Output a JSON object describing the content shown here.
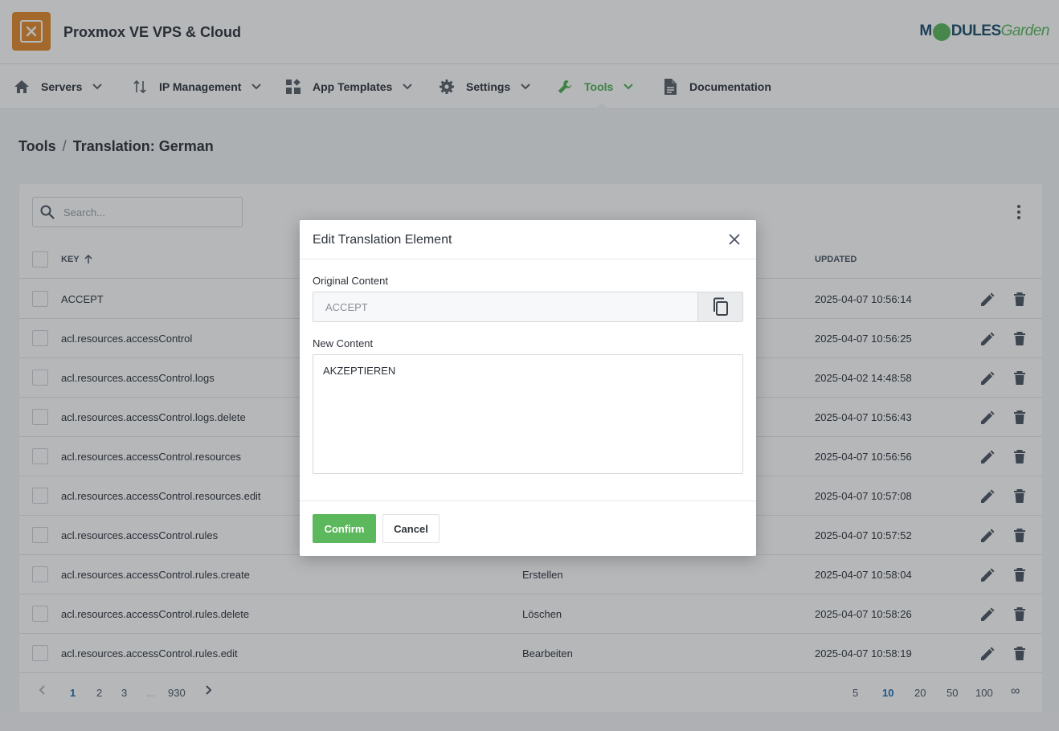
{
  "app": {
    "title": "Proxmox VE VPS & Cloud",
    "logo_icon": "proxmox-icon"
  },
  "brand": {
    "part1": "M",
    "part2": "DULES",
    "part3": "Garden"
  },
  "nav": [
    {
      "label": "Servers",
      "icon": "home-icon"
    },
    {
      "label": "IP Management",
      "icon": "sort-arrows-icon"
    },
    {
      "label": "App Templates",
      "icon": "widgets-icon"
    },
    {
      "label": "Settings",
      "icon": "gear-icon"
    },
    {
      "label": "Tools",
      "icon": "wrench-icon",
      "active": true
    },
    {
      "label": "Documentation",
      "icon": "document-icon"
    }
  ],
  "breadcrumb": {
    "parent": "Tools",
    "separator": "/",
    "current": "Translation: German"
  },
  "search": {
    "placeholder": "Search..."
  },
  "table": {
    "headers": {
      "key": "KEY",
      "updated": "UPDATED"
    },
    "rows": [
      {
        "key": "ACCEPT",
        "translation": "",
        "updated": "2025-04-07 10:56:14"
      },
      {
        "key": "acl.resources.accessControl",
        "translation": "",
        "updated": "2025-04-07 10:56:25"
      },
      {
        "key": "acl.resources.accessControl.logs",
        "translation": "",
        "updated": "2025-04-02 14:48:58"
      },
      {
        "key": "acl.resources.accessControl.logs.delete",
        "translation": "",
        "updated": "2025-04-07 10:56:43"
      },
      {
        "key": "acl.resources.accessControl.resources",
        "translation": "",
        "updated": "2025-04-07 10:56:56"
      },
      {
        "key": "acl.resources.accessControl.resources.edit",
        "translation": "",
        "updated": "2025-04-07 10:57:08"
      },
      {
        "key": "acl.resources.accessControl.rules",
        "translation": "",
        "updated": "2025-04-07 10:57:52"
      },
      {
        "key": "acl.resources.accessControl.rules.create",
        "translation": "Erstellen",
        "updated": "2025-04-07 10:58:04"
      },
      {
        "key": "acl.resources.accessControl.rules.delete",
        "translation": "Löschen",
        "updated": "2025-04-07 10:58:26"
      },
      {
        "key": "acl.resources.accessControl.rules.edit",
        "translation": "Bearbeiten",
        "updated": "2025-04-07 10:58:19"
      }
    ]
  },
  "pagination": {
    "pages": [
      "1",
      "2",
      "3",
      "...",
      "930"
    ],
    "current_page": "1",
    "page_sizes": [
      "5",
      "10",
      "20",
      "50",
      "100",
      "∞"
    ],
    "current_size": "10"
  },
  "modal": {
    "title": "Edit Translation Element",
    "original_label": "Original Content",
    "original_value": "ACCEPT",
    "new_label": "New Content",
    "new_value": "AKZEPTIEREN",
    "confirm": "Confirm",
    "cancel": "Cancel"
  },
  "colors": {
    "accent": "#5cb85c",
    "active_nav": "#4caf50",
    "logo_bg": "#e58a2c",
    "link": "#1f6fb2"
  }
}
